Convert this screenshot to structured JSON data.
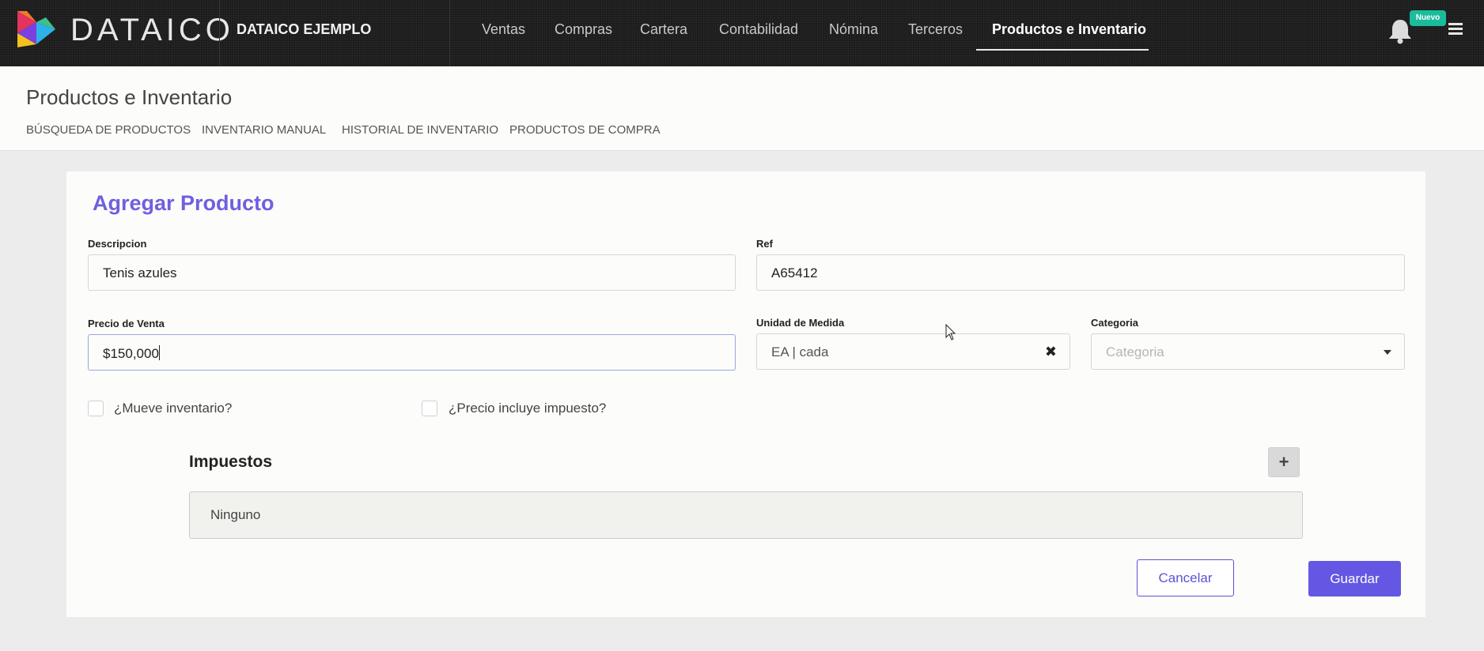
{
  "header": {
    "brand": "DATAICO",
    "company": "DATAICO EJEMPLO",
    "nav": [
      "Ventas",
      "Compras",
      "Cartera",
      "Contabilidad",
      "Nómina",
      "Terceros",
      "Productos e Inventario"
    ],
    "active_nav": "Productos e Inventario",
    "badge": "Nuevo"
  },
  "subheader": {
    "title": "Productos e Inventario",
    "tabs": [
      "BÚSQUEDA DE PRODUCTOS",
      "INVENTARIO MANUAL",
      "HISTORIAL DE INVENTARIO",
      "PRODUCTOS DE COMPRA"
    ]
  },
  "form": {
    "title": "Agregar Producto",
    "descripcion_label": "Descripcion",
    "descripcion_value": "Tenis azules",
    "ref_label": "Ref",
    "ref_value": "A65412",
    "precio_label": "Precio de Venta",
    "precio_value": "$150,000",
    "unidad_label": "Unidad de Medida",
    "unidad_value": "EA | cada",
    "categoria_label": "Categoria",
    "categoria_placeholder": "Categoria",
    "mueve_inventario_label": "¿Mueve inventario?",
    "precio_incluye_label": "¿Precio incluye impuesto?",
    "impuestos_title": "Impuestos",
    "impuestos_value": "Ninguno",
    "cancel_label": "Cancelar",
    "save_label": "Guardar"
  },
  "colors": {
    "accent": "#6457e3",
    "title_purple": "#6f5fe0",
    "badge_green": "#1abc9c",
    "topbar": "#1c1c1c"
  }
}
